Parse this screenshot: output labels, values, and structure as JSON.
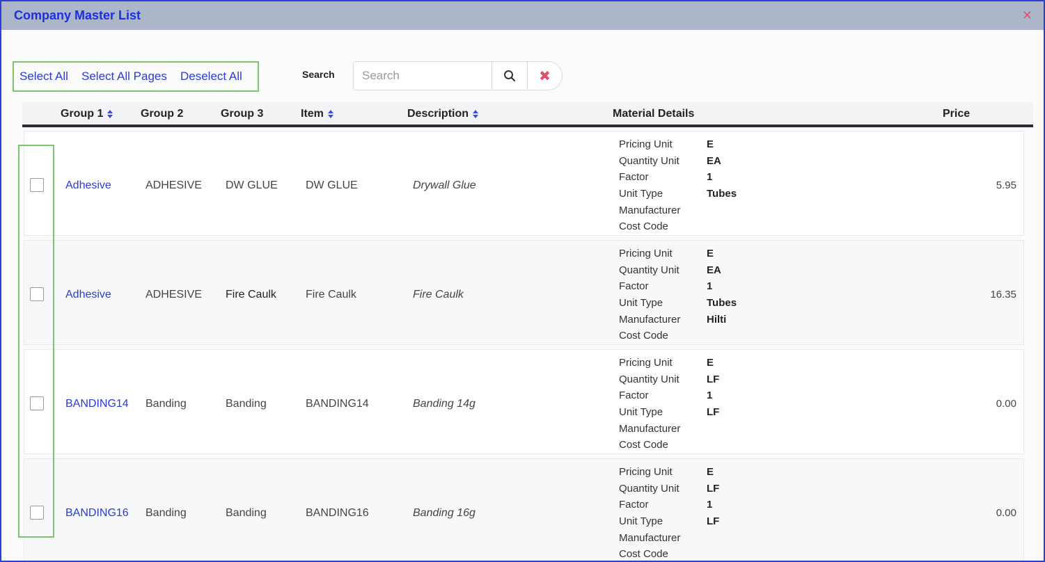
{
  "window": {
    "title": "Company Master List",
    "close_icon": "close-icon"
  },
  "toolbar": {
    "select_all": "Select All",
    "select_all_pages": "Select All Pages",
    "deselect_all": "Deselect All",
    "search_label": "Search",
    "search_placeholder": "Search",
    "search_value": ""
  },
  "columns": {
    "group1": "Group 1",
    "group2": "Group 2",
    "group3": "Group 3",
    "item": "Item",
    "description": "Description",
    "material_details": "Material Details",
    "price": "Price"
  },
  "detail_labels": [
    "Pricing Unit",
    "Quantity Unit",
    "Factor",
    "Unit Type",
    "Manufacturer",
    "Cost Code"
  ],
  "rows": [
    {
      "group1": "Adhesive",
      "group2": "ADHESIVE",
      "group3": "DW GLUE",
      "item": "DW GLUE",
      "description": "Drywall Glue",
      "details": [
        "E",
        "EA",
        "1",
        "Tubes",
        "",
        ""
      ],
      "price": "5.95",
      "checked": false
    },
    {
      "group1": "Adhesive",
      "group2": "ADHESIVE",
      "group3": "Fire Caulk",
      "item": "Fire Caulk",
      "description": "Fire Caulk",
      "details": [
        "E",
        "EA",
        "1",
        "Tubes",
        "Hilti",
        ""
      ],
      "price": "16.35",
      "checked": false
    },
    {
      "group1": "BANDING14",
      "group2": "Banding",
      "group3": "Banding",
      "item": "BANDING14",
      "description": "Banding 14g",
      "details": [
        "E",
        "LF",
        "1",
        "LF",
        "",
        ""
      ],
      "price": "0.00",
      "checked": false
    },
    {
      "group1": "BANDING16",
      "group2": "Banding",
      "group3": "Banding",
      "item": "BANDING16",
      "description": "Banding 16g",
      "details": [
        "E",
        "LF",
        "1",
        "LF",
        "",
        ""
      ],
      "price": "0.00",
      "checked": false
    }
  ]
}
